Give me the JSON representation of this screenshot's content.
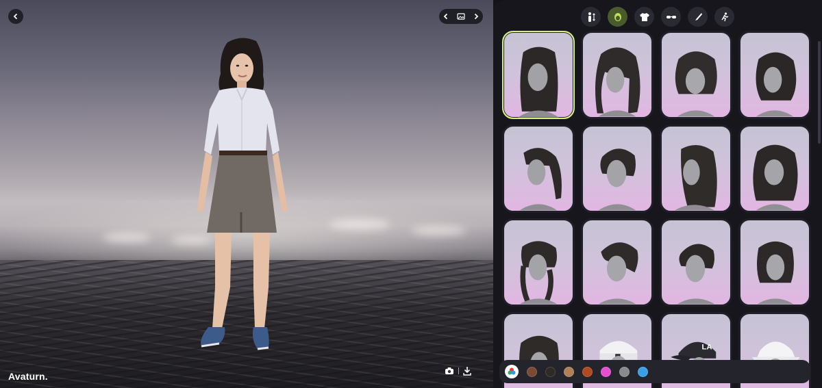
{
  "brand": {
    "name": "Avaturn."
  },
  "viewport": {
    "back_icon": "chevron-left-icon",
    "view_toggle": {
      "prev_icon": "chevron-left-icon",
      "image_icon": "image-icon",
      "next_icon": "chevron-right-icon"
    },
    "tools": {
      "camera_icon": "camera-icon",
      "separator": "|",
      "download_icon": "download-icon"
    }
  },
  "categories": [
    {
      "name": "body",
      "icon": "body-icon",
      "active": false
    },
    {
      "name": "hair",
      "icon": "hair-icon",
      "active": true
    },
    {
      "name": "outfit",
      "icon": "tshirt-icon",
      "active": false
    },
    {
      "name": "eyewear",
      "icon": "glasses-icon",
      "active": false
    },
    {
      "name": "makeup",
      "icon": "brush-icon",
      "active": false
    },
    {
      "name": "animation",
      "icon": "running-icon",
      "active": false
    }
  ],
  "hair_items": [
    {
      "style": "long-wavy",
      "selected": true
    },
    {
      "style": "long-side-swept",
      "selected": false
    },
    {
      "style": "medium-layered",
      "selected": false
    },
    {
      "style": "bob-curly",
      "selected": false
    },
    {
      "style": "ponytail",
      "selected": false
    },
    {
      "style": "short-pixie",
      "selected": false
    },
    {
      "style": "long-straight",
      "selected": false
    },
    {
      "style": "shoulder-wavy",
      "selected": false
    },
    {
      "style": "braids",
      "selected": false
    },
    {
      "style": "side-swept-short",
      "selected": false
    },
    {
      "style": "short-crop",
      "selected": false
    },
    {
      "style": "straight-bob",
      "selected": false
    },
    {
      "style": "bangs-bob",
      "selected": false
    },
    {
      "style": "white-beanie",
      "selected": false
    },
    {
      "style": "la-cap",
      "selected": false
    },
    {
      "style": "white-bucket-hat",
      "selected": false
    }
  ],
  "colors": {
    "accent_selected": "#d6f27a",
    "active_category": "#4b5a2d",
    "swatches": [
      "#7a4a35",
      "#2e2a26",
      "#b08058",
      "#b04a22",
      "#e64fd0",
      "#8a8a8a",
      "#3aa0e6"
    ]
  }
}
